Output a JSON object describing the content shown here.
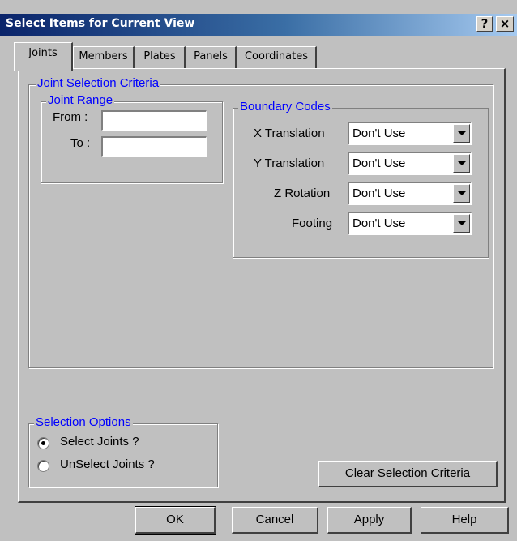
{
  "window": {
    "title": "Select Items for Current View",
    "help_label": "?",
    "close_label": "×"
  },
  "tabs": [
    "Joints",
    "Members",
    "Plates",
    "Panels",
    "Coordinates"
  ],
  "active_tab": "Joints",
  "criteria": {
    "legend": "Joint Selection Criteria",
    "range": {
      "legend": "Joint Range",
      "from_label": "From :",
      "from_value": "",
      "to_label": "To :",
      "to_value": ""
    },
    "boundary": {
      "legend": "Boundary Codes",
      "rows": [
        {
          "label": "X Translation",
          "value": "Don't Use"
        },
        {
          "label": "Y Translation",
          "value": "Don't Use"
        },
        {
          "label": "Z Rotation",
          "value": "Don't Use"
        },
        {
          "label": "Footing",
          "value": "Don't Use"
        }
      ]
    }
  },
  "selection_options": {
    "legend": "Selection Options",
    "options": [
      {
        "label": "Select Joints ?",
        "checked": true
      },
      {
        "label": "UnSelect Joints ?",
        "checked": false
      }
    ]
  },
  "clear_button": "Clear Selection Criteria",
  "footer": {
    "ok": "OK",
    "cancel": "Cancel",
    "apply": "Apply",
    "help": "Help"
  }
}
